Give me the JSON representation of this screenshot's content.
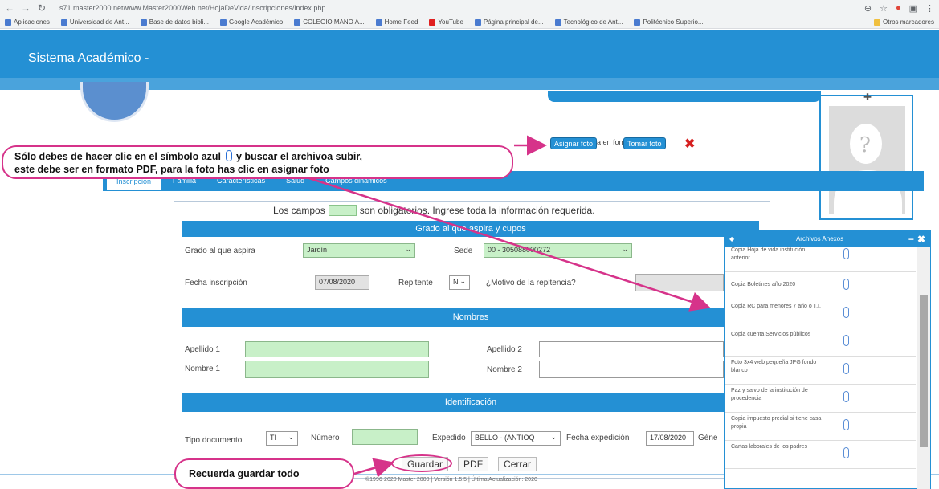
{
  "browser": {
    "url": "s71.master2000.net/www.Master2000Web.net/HojaDeVida/Inscripciones/index.php",
    "bookmarks": [
      "Aplicaciones",
      "Universidad de Ant...",
      "Base de datos bibli...",
      "Google Académico",
      "COLEGIO MANO A...",
      "Home Feed",
      "YouTube",
      "Página principal de...",
      "Tecnológico de Ant...",
      "Politécnico Superio...",
      "Otros marcadores"
    ]
  },
  "app": {
    "title": "Sistema Académico -"
  },
  "photo": {
    "note": "Foto: se guarda en formato .jpg",
    "assign_label": "Asignar foto",
    "take_label": "Tomar foto"
  },
  "callouts": {
    "instruction_line1": "Sólo debes de hacer clic en el símbolo azul",
    "instruction_line1b": "y buscar el archivoa subir,",
    "instruction_line2": "este debe ser en formato PDF, para la foto has clic en asignar foto",
    "save_reminder": "Recuerda guardar todo"
  },
  "tabs": [
    "Inscripción",
    "Familia",
    "Características",
    "Salud",
    "Campos dinámicos"
  ],
  "form": {
    "required_prefix": "Los campos",
    "required_suffix": "son obligatorios. Ingrese toda la información requerida.",
    "sec_grado": "Grado al que aspira y cupos",
    "grado_label": "Grado al que aspira",
    "grado_value": "Jardín",
    "sede_label": "Sede",
    "sede_value": "00 - 305088000272",
    "fecha_label": "Fecha inscripción",
    "fecha_value": "07/08/2020",
    "repitente_label": "Repitente",
    "repitente_value": "N",
    "motivo_label": "¿Motivo de la repitencia?",
    "sec_nombres": "Nombres",
    "apellido1_label": "Apellido 1",
    "apellido2_label": "Apellido 2",
    "nombre1_label": "Nombre 1",
    "nombre2_label": "Nombre 2",
    "sec_ident": "Identificación",
    "tipo_doc_label": "Tipo documento",
    "tipo_doc_value": "TI",
    "numero_label": "Número",
    "expedido_label": "Expedido",
    "expedido_value": "BELLO - (ANTIOQ",
    "fecha_exp_label": "Fecha expedición",
    "fecha_exp_value": "17/08/2020",
    "genero_label": "Géne"
  },
  "footer": {
    "guardar": "Guardar",
    "pdf": "PDF",
    "cerrar": "Cerrar",
    "copyright": "©1996-2020 Master 2000 | Versión 1.5.5 | Última Actualización: 2020"
  },
  "anexos": {
    "title": "Archivos Anexos",
    "items": [
      "Copia Hoja de vida institución anterior",
      "Copia Boletines año 2020",
      "Copia RC para menores 7 año o T.I.",
      "Copia cuenta Servicios públicos",
      "Foto 3x4 web pequeña JPG fondo blanco",
      "Paz y salvo de la institución de procedencia",
      "Copia impuesto predial si tiene casa propia",
      "Cartas laborales de los padres"
    ]
  },
  "colors": {
    "primary": "#2490d4",
    "callout_border": "#d6338a",
    "required_field": "#c8f0c8"
  }
}
